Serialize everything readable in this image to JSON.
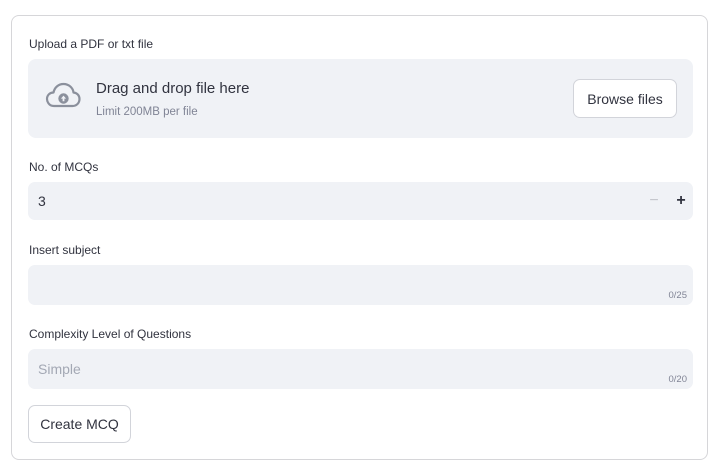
{
  "uploader": {
    "label": "Upload a PDF or txt file",
    "drop_title": "Drag and drop file here",
    "limit_text": "Limit 200MB per file",
    "browse_label": "Browse files",
    "icon": "cloud-upload-icon"
  },
  "mcq_count": {
    "label": "No. of MCQs",
    "value": "3",
    "minus_symbol": "−",
    "plus_symbol": "+"
  },
  "subject": {
    "label": "Insert subject",
    "value": "",
    "placeholder": "",
    "counter": "0/25"
  },
  "complexity": {
    "label": "Complexity Level of Questions",
    "value": "",
    "placeholder": "Simple",
    "counter": "0/20"
  },
  "actions": {
    "create_label": "Create MCQ"
  }
}
